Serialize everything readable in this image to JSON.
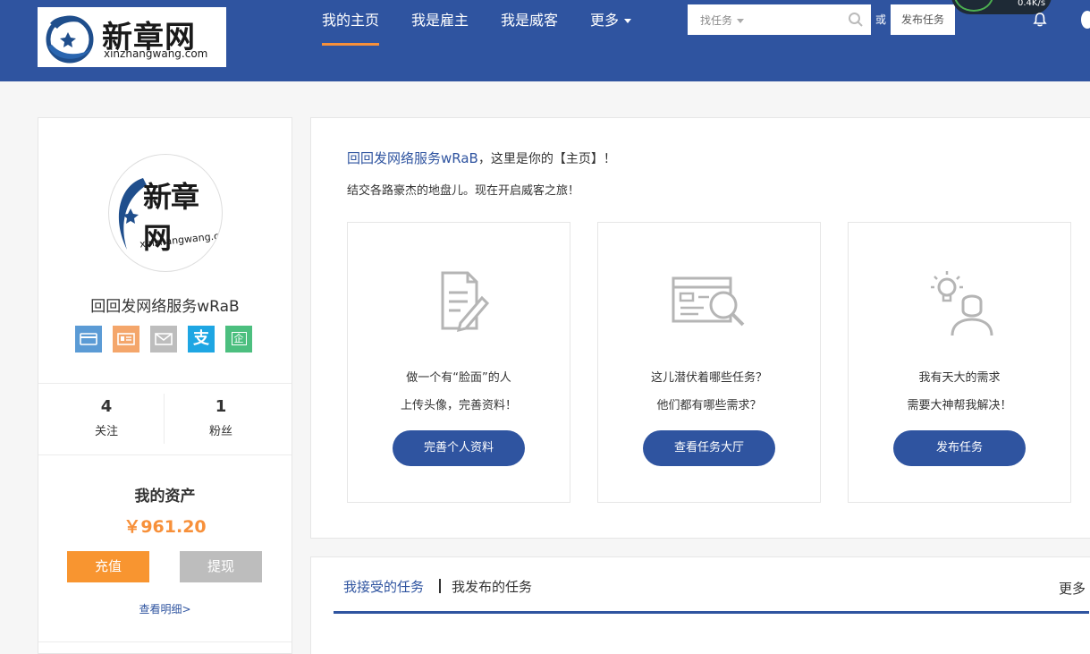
{
  "header": {
    "logo": {
      "text": "新章网",
      "domain": "xinzhangwang.com"
    },
    "nav": [
      {
        "label": "我的主页"
      },
      {
        "label": "我是雇主"
      },
      {
        "label": "我是威客"
      },
      {
        "label": "更多"
      }
    ],
    "search": {
      "select_label": "找任务"
    },
    "or_label": "或",
    "post_task_label": "发布任务",
    "speed": "0.4K/s"
  },
  "profile": {
    "avatar": {
      "text": "新章网",
      "domain": "xinzhangwang.com"
    },
    "username": "回回发网络服务wRaB",
    "auth_icons": [
      {
        "name": "bank-card-icon",
        "color": "#5b9bd5"
      },
      {
        "name": "id-card-icon",
        "color": "#f4a66b"
      },
      {
        "name": "email-icon",
        "color": "#bdbdbd"
      },
      {
        "name": "alipay-icon",
        "color": "#1ea6e3",
        "glyph": "支"
      },
      {
        "name": "business-license-icon",
        "color": "#4cbf7f",
        "glyph": "企"
      }
    ],
    "stats": [
      {
        "value": "4",
        "label": "关注"
      },
      {
        "value": "1",
        "label": "粉丝"
      }
    ],
    "assets": {
      "title": "我的资产",
      "amount": "￥961.20",
      "recharge_label": "充值",
      "withdraw_label": "提现",
      "detail_label": "查看明细>"
    }
  },
  "welcome": {
    "username": "回回发网络服务wRaB",
    "suffix": "，这里是你的【主页】！",
    "subtitle": "结交各路豪杰的地盘儿。现在开启威客之旅！"
  },
  "features": [
    {
      "icon": "document-edit-icon",
      "line1": "做一个有“脸面”的人",
      "line2": "上传头像，完善资料！",
      "button": "完善个人资料"
    },
    {
      "icon": "task-search-icon",
      "line1": "这儿潜伏着哪些任务？",
      "line2": "他们都有哪些需求？",
      "button": "查看任务大厅"
    },
    {
      "icon": "idea-person-icon",
      "line1": "我有天大的需求",
      "line2": "需要大神帮我解决！",
      "button": "发布任务"
    }
  ],
  "tasks": {
    "tabs": [
      {
        "label": "我接受的任务"
      },
      {
        "label": "我发布的任务"
      }
    ],
    "more_label": "更多"
  }
}
